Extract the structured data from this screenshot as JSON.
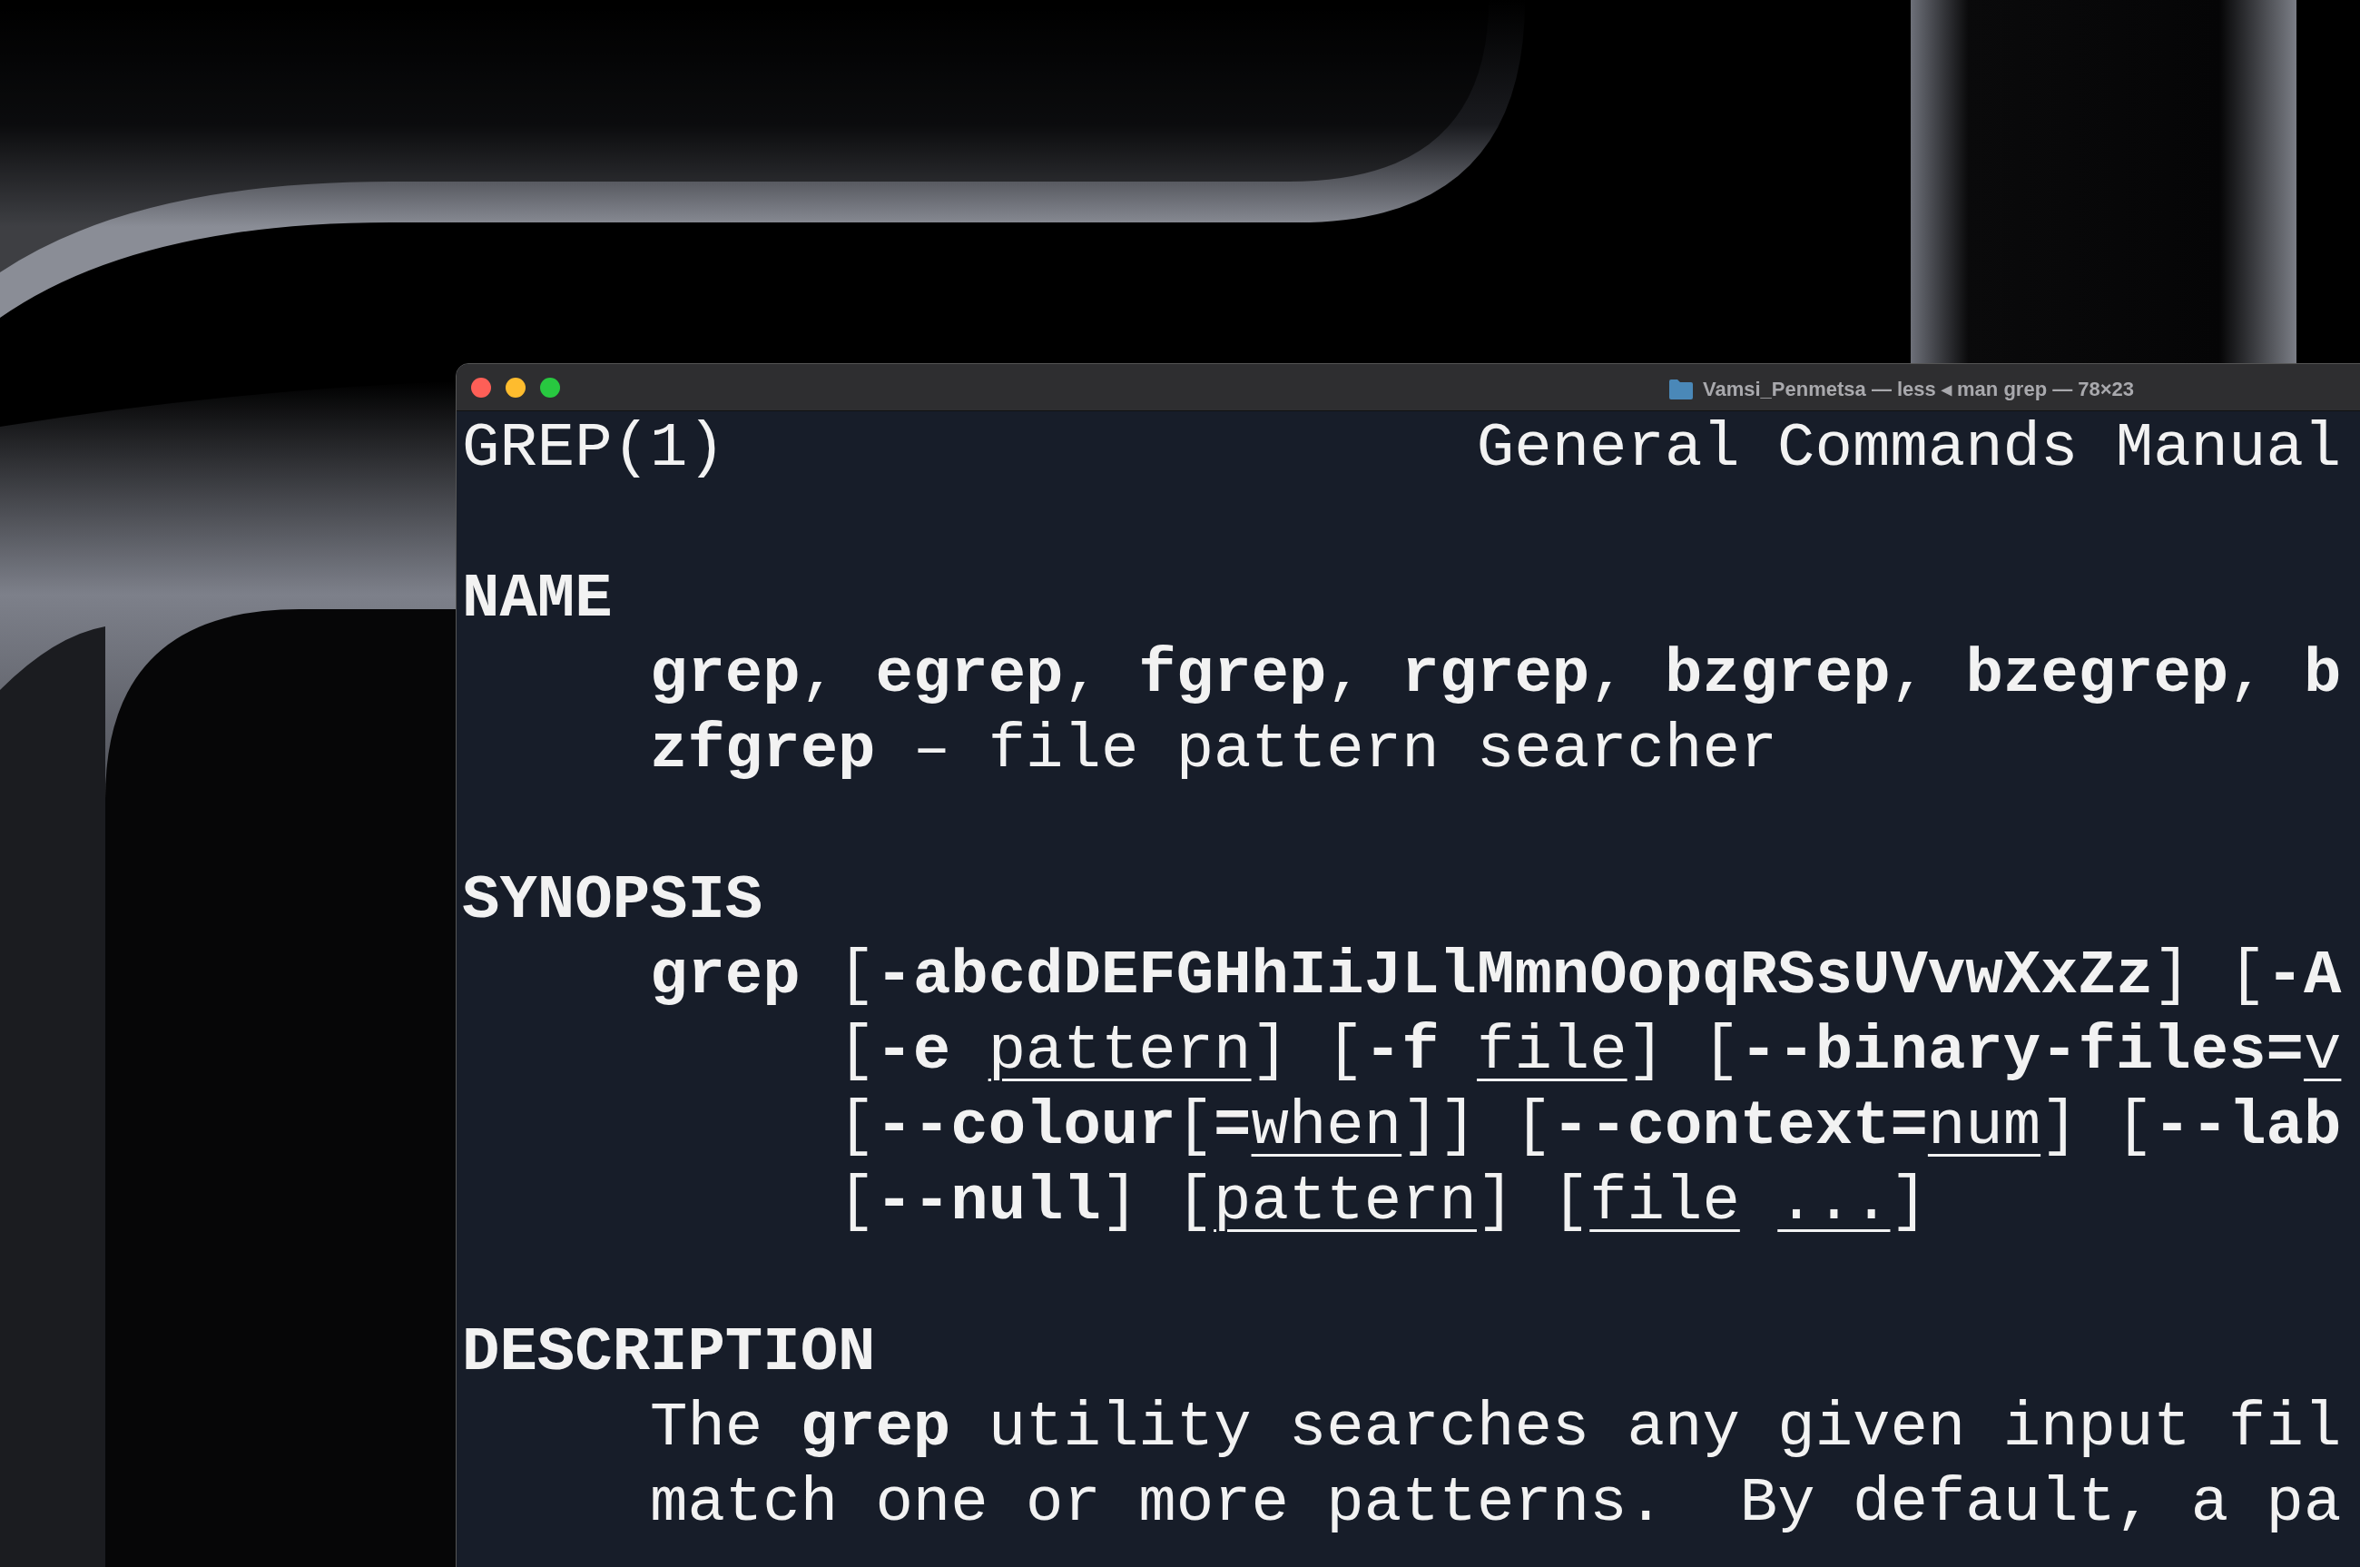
{
  "window": {
    "title": "Vamsi_Penmetsa — less ◂ man grep — 78×23"
  },
  "header": {
    "left": "GREP(1)",
    "right": "General Commands Manual"
  },
  "sections": [
    {
      "heading": "NAME",
      "lines": [
        {
          "kind": "body",
          "segments": [
            {
              "kind": "bold",
              "text": "grep"
            },
            {
              "kind": "plain",
              "text": ", "
            },
            {
              "kind": "bold",
              "text": "egrep"
            },
            {
              "kind": "plain",
              "text": ", "
            },
            {
              "kind": "bold",
              "text": "fgrep"
            },
            {
              "kind": "plain",
              "text": ", "
            },
            {
              "kind": "bold",
              "text": "rgrep"
            },
            {
              "kind": "plain",
              "text": ", "
            },
            {
              "kind": "bold",
              "text": "bzgrep"
            },
            {
              "kind": "plain",
              "text": ", "
            },
            {
              "kind": "bold",
              "text": "bzegrep"
            },
            {
              "kind": "plain",
              "text": ", "
            },
            {
              "kind": "bold",
              "text": "b"
            }
          ]
        },
        {
          "kind": "body",
          "segments": [
            {
              "kind": "bold",
              "text": "zfgrep"
            },
            {
              "kind": "plain",
              "text": " – file pattern searcher"
            }
          ]
        }
      ]
    },
    {
      "heading": "SYNOPSIS",
      "lines": [
        {
          "kind": "body",
          "segments": [
            {
              "kind": "bold",
              "text": "grep"
            },
            {
              "kind": "plain",
              "text": " ["
            },
            {
              "kind": "bold",
              "text": "-abcdDEFGHhIiJLlMmnOopqRSsUVvwXxZz"
            },
            {
              "kind": "plain",
              "text": "] ["
            },
            {
              "kind": "bold",
              "text": "-A"
            }
          ]
        },
        {
          "kind": "continuation",
          "segments": [
            {
              "kind": "plain",
              "text": "["
            },
            {
              "kind": "bold",
              "text": "-e "
            },
            {
              "kind": "underline",
              "text": "pattern"
            },
            {
              "kind": "plain",
              "text": "] ["
            },
            {
              "kind": "bold",
              "text": "-f "
            },
            {
              "kind": "underline",
              "text": "file"
            },
            {
              "kind": "plain",
              "text": "] ["
            },
            {
              "kind": "bold",
              "text": "--binary-files="
            },
            {
              "kind": "underline",
              "text": "v"
            }
          ]
        },
        {
          "kind": "continuation",
          "segments": [
            {
              "kind": "plain",
              "text": "["
            },
            {
              "kind": "bold",
              "text": "--colour"
            },
            {
              "kind": "plain",
              "text": "["
            },
            {
              "kind": "bold",
              "text": "="
            },
            {
              "kind": "underline",
              "text": "when"
            },
            {
              "kind": "plain",
              "text": "]] ["
            },
            {
              "kind": "bold",
              "text": "--context="
            },
            {
              "kind": "underline",
              "text": "num"
            },
            {
              "kind": "plain",
              "text": "] ["
            },
            {
              "kind": "bold",
              "text": "--lab"
            }
          ]
        },
        {
          "kind": "continuation",
          "segments": [
            {
              "kind": "plain",
              "text": "["
            },
            {
              "kind": "bold",
              "text": "--null"
            },
            {
              "kind": "plain",
              "text": "] ["
            },
            {
              "kind": "underline",
              "text": "pattern"
            },
            {
              "kind": "plain",
              "text": "] ["
            },
            {
              "kind": "underline",
              "text": "file"
            },
            {
              "kind": "spaced_underline",
              "text": "..."
            },
            {
              "kind": "plain",
              "text": "]"
            }
          ]
        }
      ]
    },
    {
      "heading": "DESCRIPTION",
      "lines": [
        {
          "kind": "body",
          "segments": [
            {
              "kind": "plain",
              "text": "The "
            },
            {
              "kind": "bold",
              "text": "grep"
            },
            {
              "kind": "plain",
              "text": " utility searches any given input fil"
            }
          ]
        },
        {
          "kind": "body",
          "segments": [
            {
              "kind": "plain",
              "text": "match one or more patterns.  By default, a pa"
            }
          ]
        }
      ]
    }
  ]
}
